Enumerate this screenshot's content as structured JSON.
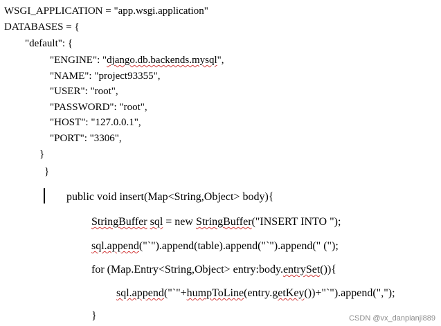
{
  "config": {
    "lines": [
      "WSGI_APPLICATION = \"app.wsgi.application\"",
      "DATABASES = {",
      "\"default\": {",
      "\"ENGINE\": \"django.db.backends.mysql\",",
      "\"NAME\": \"project93355\",",
      "\"USER\": \"root\",",
      "\"PASSWORD\": \"root\",",
      "\"HOST\": \"127.0.0.1\",",
      "\"PORT\": \"3306\",",
      "}",
      "}"
    ]
  },
  "code": {
    "signature": "public void insert(Map<String,Object> body){",
    "line2": {
      "a": "StringBuffer",
      "b": " ",
      "c": "sql",
      "d": " = new ",
      "e": "StringBuffer",
      "f": "(\"INSERT INTO \");"
    },
    "line3": {
      "a": "sql.append",
      "b": "(\"`\").append(table).append(\"`\").append(\" (\");"
    },
    "line4": {
      "a": "for (Map.Entry<String,Object> entry:body.",
      "b": "entrySet",
      "c": "()){"
    },
    "line5": {
      "a": "sql.append",
      "b": "(\"`\"+",
      "c": "humpToLine",
      "d": "(entry.",
      "e": "getKey",
      "f": "())+\"`\").append(\",\");"
    },
    "closing": "}"
  },
  "watermark": "CSDN @vx_danpianji889"
}
